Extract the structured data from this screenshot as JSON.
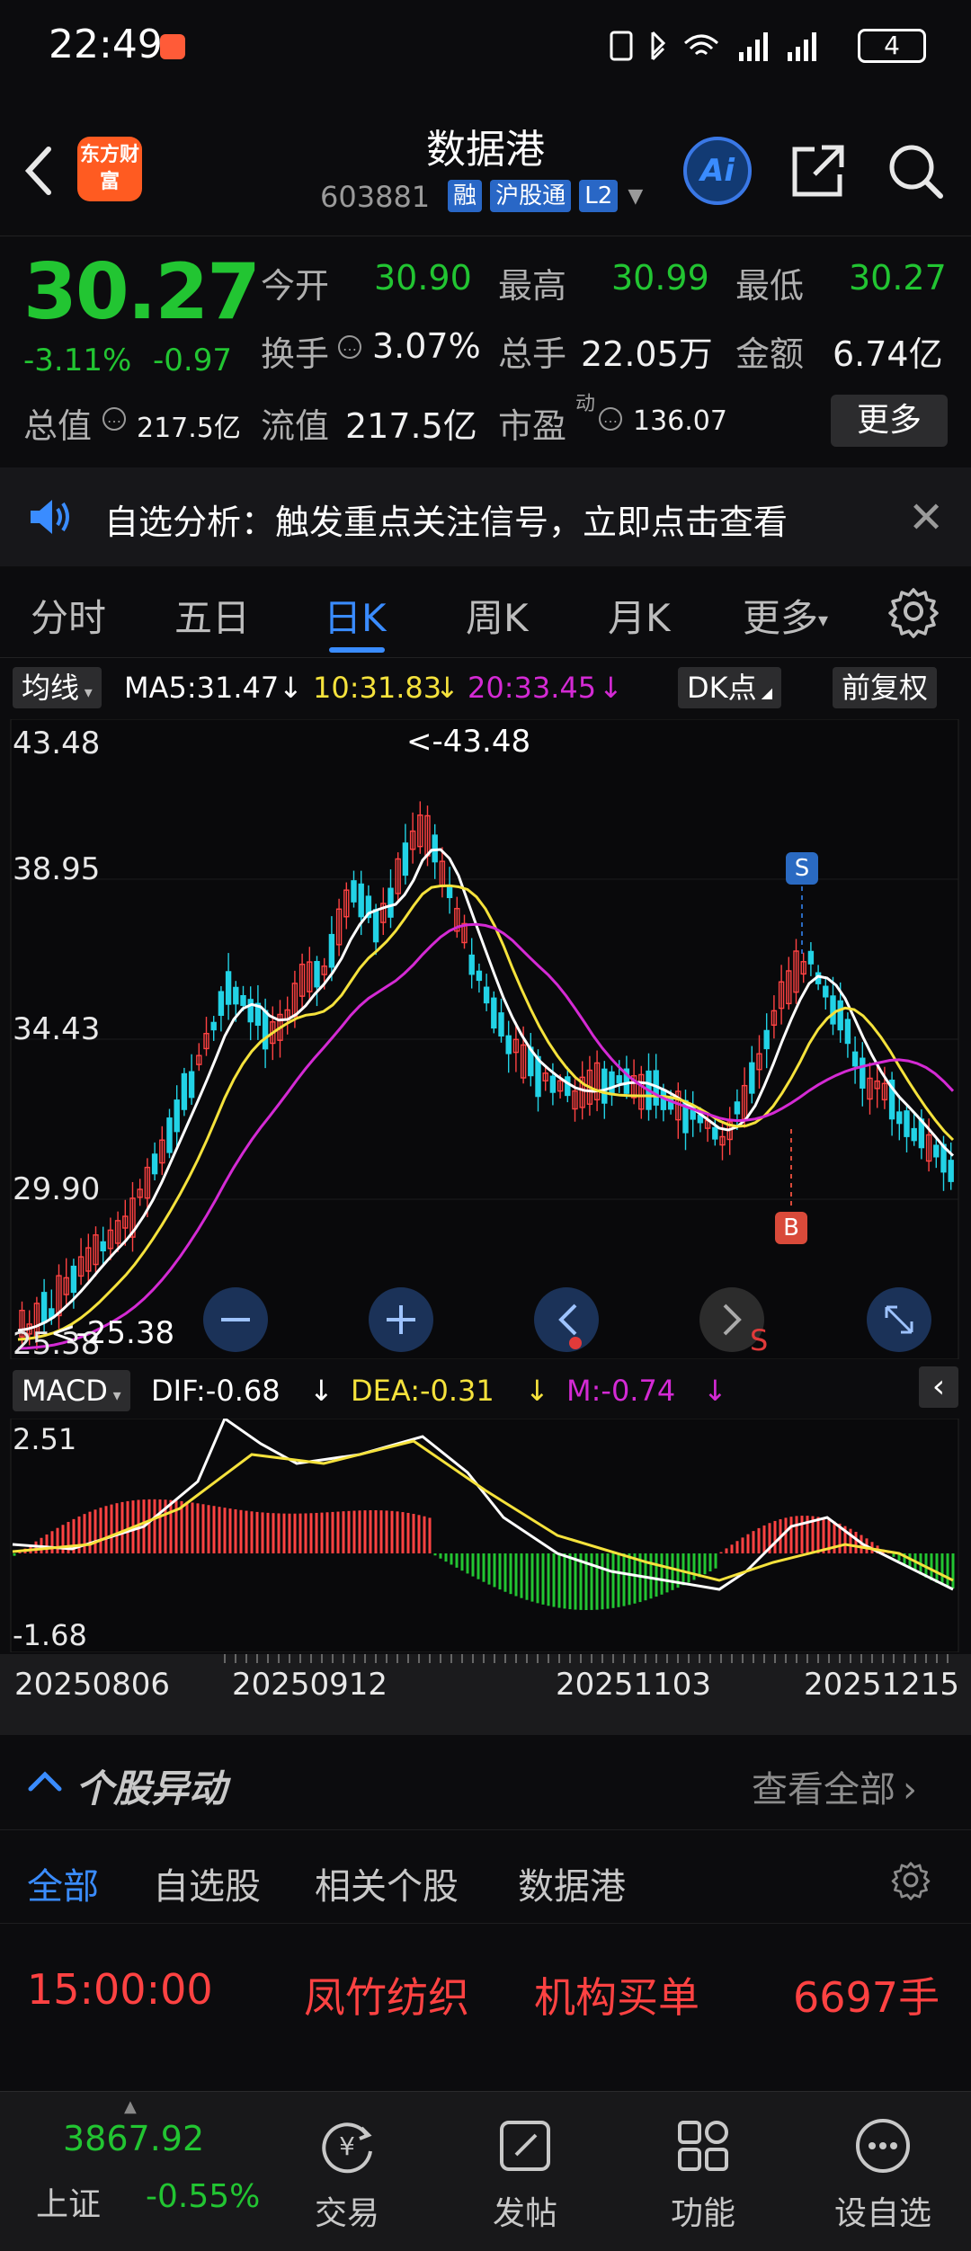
{
  "status_bar": {
    "time": "22:49",
    "battery": "4"
  },
  "header": {
    "title": "数据港",
    "logo_text": "东方财富",
    "code": "603881",
    "tags": [
      "融",
      "沪股通",
      "L2"
    ]
  },
  "quote": {
    "price": "30.27",
    "change_pct": "-3.11%",
    "change_amt": "-0.97",
    "open_label": "今开",
    "open": "30.90",
    "high_label": "最高",
    "high": "30.99",
    "low_label": "最低",
    "low": "30.27",
    "turnover_label": "换手",
    "turnover": "3.07%",
    "volume_label": "总手",
    "volume": "22.05万",
    "amount_label": "金额",
    "amount": "6.74亿",
    "mktcap_label": "总值",
    "mktcap": "217.5亿",
    "float_label": "流值",
    "float": "217.5亿",
    "pe_label": "市盈",
    "pe_sup": "动",
    "pe": "136.07",
    "more": "更多"
  },
  "notice": {
    "text": "自选分析：触发重点关注信号，立即点击查看"
  },
  "period_tabs": [
    "分时",
    "五日",
    "日K",
    "周K",
    "月K",
    "更多"
  ],
  "ma_row": {
    "indicator": "均线",
    "ma5": "MA5:31.47",
    "ma10": "10:31.83",
    "ma20": "20:33.45",
    "dk": "DK点",
    "adjust": "前复权"
  },
  "kchart": {
    "y_labels": [
      "43.48",
      "38.95",
      "34.43",
      "29.90",
      "25.38"
    ],
    "max_label": "<-43.48",
    "min_label": "<-25.38",
    "signal_sell": "S",
    "signal_buy": "B",
    "nav_sell": "S"
  },
  "macd_row": {
    "indicator": "MACD",
    "dif": "DIF:-0.68",
    "dea": "DEA:-0.31",
    "m": "M:-0.74"
  },
  "macd_chart": {
    "y_top": "2.51",
    "y_bottom": "-1.68"
  },
  "dates": [
    "20250806",
    "20250912",
    "20251103",
    "20251215"
  ],
  "movements": {
    "title": "个股异动",
    "view_all": "查看全部",
    "tabs": [
      "全部",
      "自选股",
      "相关个股",
      "数据港"
    ],
    "row": {
      "time": "15:00:00",
      "name": "凤竹纺织",
      "type": "机构买单",
      "qty": "6697手"
    }
  },
  "bottom_nav": {
    "index_value": "3867.92",
    "index_name": "上证",
    "index_change": "-0.55%",
    "items": [
      "交易",
      "发帖",
      "功能",
      "设自选"
    ]
  },
  "colors": {
    "up": "#ff4242",
    "down": "#22c532",
    "accent": "#3a8cff",
    "ma5": "#ffffff",
    "ma10": "#f5e23c",
    "ma20": "#d42ad4"
  }
}
